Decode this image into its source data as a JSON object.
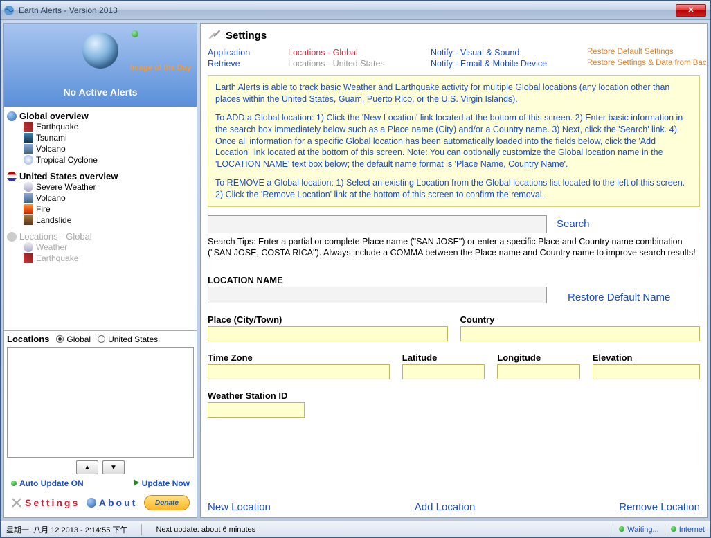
{
  "window": {
    "title": "Earth Alerts - Version 2013"
  },
  "sidebar": {
    "image_of_day": "Image of the Day",
    "no_alerts": "No Active Alerts",
    "sections": [
      {
        "head": "Global overview",
        "items": [
          "Earthquake",
          "Tsunami",
          "Volcano",
          "Tropical Cyclone"
        ]
      },
      {
        "head": "United States overview",
        "items": [
          "Severe Weather",
          "Volcano",
          "Fire",
          "Landslide"
        ]
      },
      {
        "head": "Locations - Global",
        "disabled": true,
        "items": [
          "Weather",
          "Earthquake"
        ]
      }
    ],
    "locations_label": "Locations",
    "radio_global": "Global",
    "radio_us": "United States",
    "auto_update": "Auto Update ON",
    "update_now": "Update Now",
    "settings_link": "Settings",
    "about_link": "About",
    "donate": "Donate"
  },
  "settings": {
    "title": "Settings",
    "tabs": {
      "application": "Application",
      "retrieve": "Retrieve",
      "loc_global": "Locations - Global",
      "loc_us": "Locations - United States",
      "notify_vs": "Notify - Visual & Sound",
      "notify_em": "Notify - Email & Mobile Device",
      "restore_def": "Restore Default Settings",
      "restore_backup": "Restore Settings & Data from Backup Files"
    },
    "info_p1": "Earth Alerts is able to track basic Weather and Earthquake activity for multiple Global locations (any location other than places within the United States, Guam, Puerto Rico, or the U.S. Virgin Islands).",
    "info_p2": "To ADD a Global location:  1) Click the 'New Location' link located at the bottom of this screen.  2) Enter basic information in the search box immediately below such as a Place name (City) and/or a Country name.  3) Next, click the 'Search' link.  4) Once all information for a specific Global location has been automatically loaded into the fields below, click the 'Add Location' link located at the bottom of this screen.  Note: You can optionally customize the Global location name in the 'LOCATION NAME' text box below; the default name format is 'Place Name, Country Name'.",
    "info_p3": "To REMOVE a Global location:  1) Select an existing Location from the Global locations list located to the left of this screen.  2) Click the 'Remove Location' link at the bottom of this screen to confirm the removal.",
    "search_link": "Search",
    "search_tips": "Search Tips: Enter a partial or complete Place name (\"SAN JOSE\") or enter a specific Place and Country name combination (\"SAN JOSE, COSTA RICA\").  Always include a COMMA between the Place name and Country name to improve search results!",
    "labels": {
      "location_name": "LOCATION NAME",
      "restore_name": "Restore Default Name",
      "place": "Place (City/Town)",
      "country": "Country",
      "timezone": "Time Zone",
      "latitude": "Latitude",
      "longitude": "Longitude",
      "elevation": "Elevation",
      "station": "Weather Station ID"
    },
    "actions": {
      "new_loc": "New Location",
      "add_loc": "Add Location",
      "remove_loc": "Remove Location"
    }
  },
  "status": {
    "datetime": "星期一, 八月 12 2013 - 2:14:55 下午",
    "next_update": "Next update: about 6 minutes",
    "waiting": "Waiting...",
    "internet": "Internet"
  }
}
